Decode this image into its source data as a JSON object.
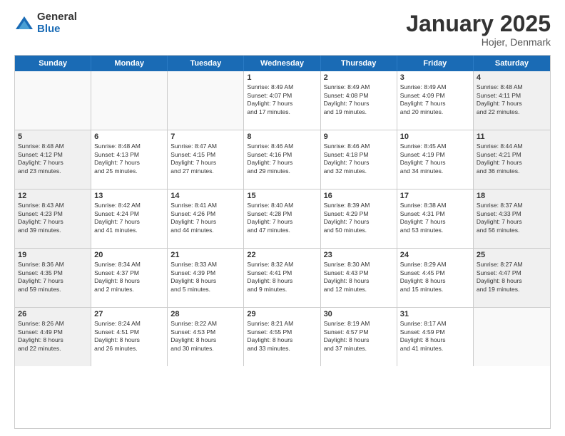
{
  "header": {
    "logo": {
      "general": "General",
      "blue": "Blue"
    },
    "title": "January 2025",
    "location": "Hojer, Denmark"
  },
  "weekdays": [
    "Sunday",
    "Monday",
    "Tuesday",
    "Wednesday",
    "Thursday",
    "Friday",
    "Saturday"
  ],
  "weeks": [
    [
      {
        "day": "",
        "text": ""
      },
      {
        "day": "",
        "text": ""
      },
      {
        "day": "",
        "text": ""
      },
      {
        "day": "1",
        "text": "Sunrise: 8:49 AM\nSunset: 4:07 PM\nDaylight: 7 hours\nand 17 minutes."
      },
      {
        "day": "2",
        "text": "Sunrise: 8:49 AM\nSunset: 4:08 PM\nDaylight: 7 hours\nand 19 minutes."
      },
      {
        "day": "3",
        "text": "Sunrise: 8:49 AM\nSunset: 4:09 PM\nDaylight: 7 hours\nand 20 minutes."
      },
      {
        "day": "4",
        "text": "Sunrise: 8:48 AM\nSunset: 4:11 PM\nDaylight: 7 hours\nand 22 minutes."
      }
    ],
    [
      {
        "day": "5",
        "text": "Sunrise: 8:48 AM\nSunset: 4:12 PM\nDaylight: 7 hours\nand 23 minutes."
      },
      {
        "day": "6",
        "text": "Sunrise: 8:48 AM\nSunset: 4:13 PM\nDaylight: 7 hours\nand 25 minutes."
      },
      {
        "day": "7",
        "text": "Sunrise: 8:47 AM\nSunset: 4:15 PM\nDaylight: 7 hours\nand 27 minutes."
      },
      {
        "day": "8",
        "text": "Sunrise: 8:46 AM\nSunset: 4:16 PM\nDaylight: 7 hours\nand 29 minutes."
      },
      {
        "day": "9",
        "text": "Sunrise: 8:46 AM\nSunset: 4:18 PM\nDaylight: 7 hours\nand 32 minutes."
      },
      {
        "day": "10",
        "text": "Sunrise: 8:45 AM\nSunset: 4:19 PM\nDaylight: 7 hours\nand 34 minutes."
      },
      {
        "day": "11",
        "text": "Sunrise: 8:44 AM\nSunset: 4:21 PM\nDaylight: 7 hours\nand 36 minutes."
      }
    ],
    [
      {
        "day": "12",
        "text": "Sunrise: 8:43 AM\nSunset: 4:23 PM\nDaylight: 7 hours\nand 39 minutes."
      },
      {
        "day": "13",
        "text": "Sunrise: 8:42 AM\nSunset: 4:24 PM\nDaylight: 7 hours\nand 41 minutes."
      },
      {
        "day": "14",
        "text": "Sunrise: 8:41 AM\nSunset: 4:26 PM\nDaylight: 7 hours\nand 44 minutes."
      },
      {
        "day": "15",
        "text": "Sunrise: 8:40 AM\nSunset: 4:28 PM\nDaylight: 7 hours\nand 47 minutes."
      },
      {
        "day": "16",
        "text": "Sunrise: 8:39 AM\nSunset: 4:29 PM\nDaylight: 7 hours\nand 50 minutes."
      },
      {
        "day": "17",
        "text": "Sunrise: 8:38 AM\nSunset: 4:31 PM\nDaylight: 7 hours\nand 53 minutes."
      },
      {
        "day": "18",
        "text": "Sunrise: 8:37 AM\nSunset: 4:33 PM\nDaylight: 7 hours\nand 56 minutes."
      }
    ],
    [
      {
        "day": "19",
        "text": "Sunrise: 8:36 AM\nSunset: 4:35 PM\nDaylight: 7 hours\nand 59 minutes."
      },
      {
        "day": "20",
        "text": "Sunrise: 8:34 AM\nSunset: 4:37 PM\nDaylight: 8 hours\nand 2 minutes."
      },
      {
        "day": "21",
        "text": "Sunrise: 8:33 AM\nSunset: 4:39 PM\nDaylight: 8 hours\nand 5 minutes."
      },
      {
        "day": "22",
        "text": "Sunrise: 8:32 AM\nSunset: 4:41 PM\nDaylight: 8 hours\nand 9 minutes."
      },
      {
        "day": "23",
        "text": "Sunrise: 8:30 AM\nSunset: 4:43 PM\nDaylight: 8 hours\nand 12 minutes."
      },
      {
        "day": "24",
        "text": "Sunrise: 8:29 AM\nSunset: 4:45 PM\nDaylight: 8 hours\nand 15 minutes."
      },
      {
        "day": "25",
        "text": "Sunrise: 8:27 AM\nSunset: 4:47 PM\nDaylight: 8 hours\nand 19 minutes."
      }
    ],
    [
      {
        "day": "26",
        "text": "Sunrise: 8:26 AM\nSunset: 4:49 PM\nDaylight: 8 hours\nand 22 minutes."
      },
      {
        "day": "27",
        "text": "Sunrise: 8:24 AM\nSunset: 4:51 PM\nDaylight: 8 hours\nand 26 minutes."
      },
      {
        "day": "28",
        "text": "Sunrise: 8:22 AM\nSunset: 4:53 PM\nDaylight: 8 hours\nand 30 minutes."
      },
      {
        "day": "29",
        "text": "Sunrise: 8:21 AM\nSunset: 4:55 PM\nDaylight: 8 hours\nand 33 minutes."
      },
      {
        "day": "30",
        "text": "Sunrise: 8:19 AM\nSunset: 4:57 PM\nDaylight: 8 hours\nand 37 minutes."
      },
      {
        "day": "31",
        "text": "Sunrise: 8:17 AM\nSunset: 4:59 PM\nDaylight: 8 hours\nand 41 minutes."
      },
      {
        "day": "",
        "text": ""
      }
    ]
  ]
}
